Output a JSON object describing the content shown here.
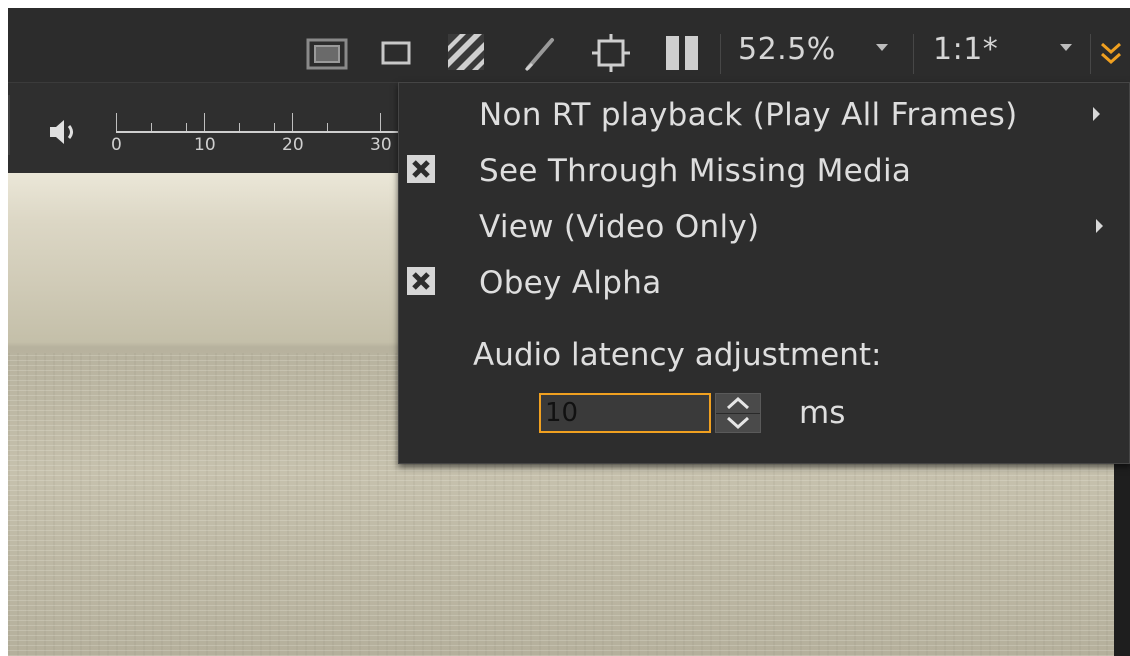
{
  "toolbar": {
    "zoom_value": "52.5%",
    "aspect_value": "1:1*",
    "icons": [
      "safe-area-icon",
      "frame-icon",
      "stripes-icon",
      "paint-icon",
      "guides-icon",
      "pause-icon",
      "expand-icon"
    ]
  },
  "timeline": {
    "ticks": [
      "0",
      "10",
      "20",
      "30"
    ]
  },
  "menu": {
    "items": [
      {
        "label": "Non RT playback (Play All Frames)",
        "checked": false,
        "submenu": true
      },
      {
        "label": "See Through Missing Media",
        "checked": true,
        "submenu": false
      },
      {
        "label": "View (Video Only)",
        "checked": false,
        "submenu": true
      },
      {
        "label": "Obey Alpha",
        "checked": true,
        "submenu": false
      }
    ],
    "latency_label": "Audio latency adjustment:",
    "latency_value": "10",
    "latency_unit": "ms"
  },
  "colors": {
    "accent": "#f0a020",
    "menu_bg": "#2d2d2d",
    "toolbar_bg": "#2c2c2c"
  }
}
